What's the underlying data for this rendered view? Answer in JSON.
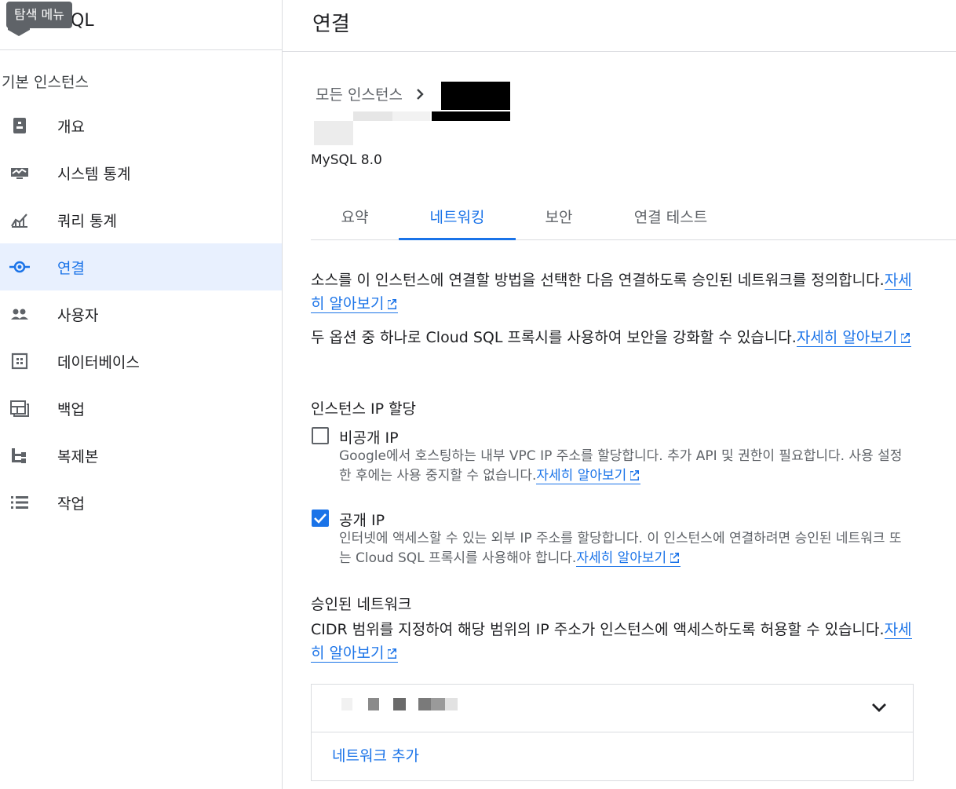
{
  "sidebar": {
    "brand_text": "QL",
    "tooltip": "탐색 메뉴",
    "section_title": "기본 인스턴스",
    "items": [
      {
        "label": "개요",
        "icon": "overview-icon"
      },
      {
        "label": "시스템 통계",
        "icon": "monitor-icon"
      },
      {
        "label": "쿼리 통계",
        "icon": "query-stats-icon"
      },
      {
        "label": "연결",
        "icon": "connection-icon",
        "active": true
      },
      {
        "label": "사용자",
        "icon": "users-icon"
      },
      {
        "label": "데이터베이스",
        "icon": "database-icon"
      },
      {
        "label": "백업",
        "icon": "backup-icon"
      },
      {
        "label": "복제본",
        "icon": "replica-icon"
      },
      {
        "label": "작업",
        "icon": "operations-icon"
      }
    ]
  },
  "header": {
    "title": "연결"
  },
  "breadcrumb": {
    "all_instances": "모든 인스턴스"
  },
  "instance": {
    "version": "MySQL 8.0"
  },
  "tabs": [
    "요약",
    "네트워킹",
    "보안",
    "연결 테스트"
  ],
  "active_tab": "네트워킹",
  "intro": {
    "p1": "소스를 이 인스턴스에 연결할 방법을 선택한 다음 연결하도록 승인된 네트워크를 정의합니다.",
    "p1_link": "자세히 알아보기",
    "p2": "두 옵션 중 하나로 Cloud SQL 프록시를 사용하여 보안을 강화할 수 있습니다.",
    "p2_link": "자세히 알아보기"
  },
  "ip_assignment": {
    "title": "인스턴스 IP 할당",
    "private": {
      "label": "비공개 IP",
      "checked": false,
      "desc": "Google에서 호스팅하는 내부 VPC IP 주소를 할당합니다. 추가 API 및 권한이 필요합니다. 사용 설정한 후에는 사용 중지할 수 없습니다.",
      "link": "자세히 알아보기"
    },
    "public": {
      "label": "공개 IP",
      "checked": true,
      "desc": "인터넷에 액세스할 수 있는 외부 IP 주소를 할당합니다. 이 인스턴스에 연결하려면 승인된 네트워크 또는 Cloud SQL 프록시를 사용해야 합니다.",
      "link": "자세히 알아보기"
    }
  },
  "authorized_networks": {
    "title": "승인된 네트워크",
    "desc": "CIDR 범위를 지정하여 해당 범위의 IP 주소가 인스턴스에 액세스하도록 허용할 수 있습니다.",
    "link": "자세히 알아보기",
    "add_label": "네트워크 추가"
  },
  "colors": {
    "accent": "#1a73e8",
    "active_bg": "#e8f0fe",
    "text": "#202124",
    "muted": "#5f6368"
  }
}
